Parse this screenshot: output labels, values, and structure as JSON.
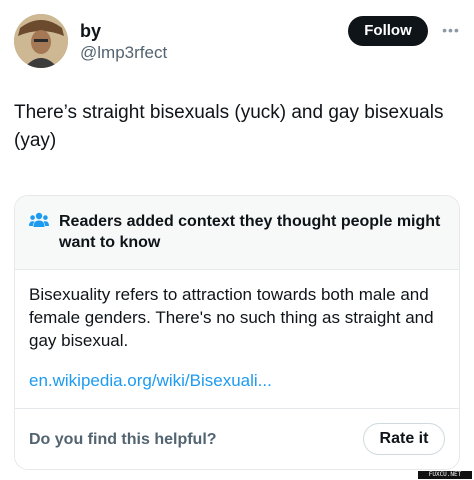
{
  "author": {
    "display_name": "by",
    "handle": "@lmp3rfect",
    "avatar_icon": "profile-photo"
  },
  "header": {
    "follow_label": "Follow",
    "more_icon": "more-horizontal-icon"
  },
  "tweet": {
    "text": "There’s straight bisexuals (yuck) and gay bisexuals (yay)"
  },
  "community_note": {
    "icon": "people-icon",
    "title": "Readers added context they thought people might want to know",
    "body": "Bisexuality refers to attraction towards both male and female genders. There's no such thing as straight and gay bisexual.",
    "link": "en.wikipedia.org/wiki/Bisexuali...",
    "helpful_question": "Do you find this helpful?",
    "rate_label": "Rate it"
  },
  "watermark": "FUXCU.NET",
  "colors": {
    "text_primary": "#0f1419",
    "text_secondary": "#536471",
    "link": "#1d9bf0",
    "note_header_bg": "#f7f9f9",
    "border": "#e6e9eb",
    "follow_bg": "#0f1419"
  }
}
